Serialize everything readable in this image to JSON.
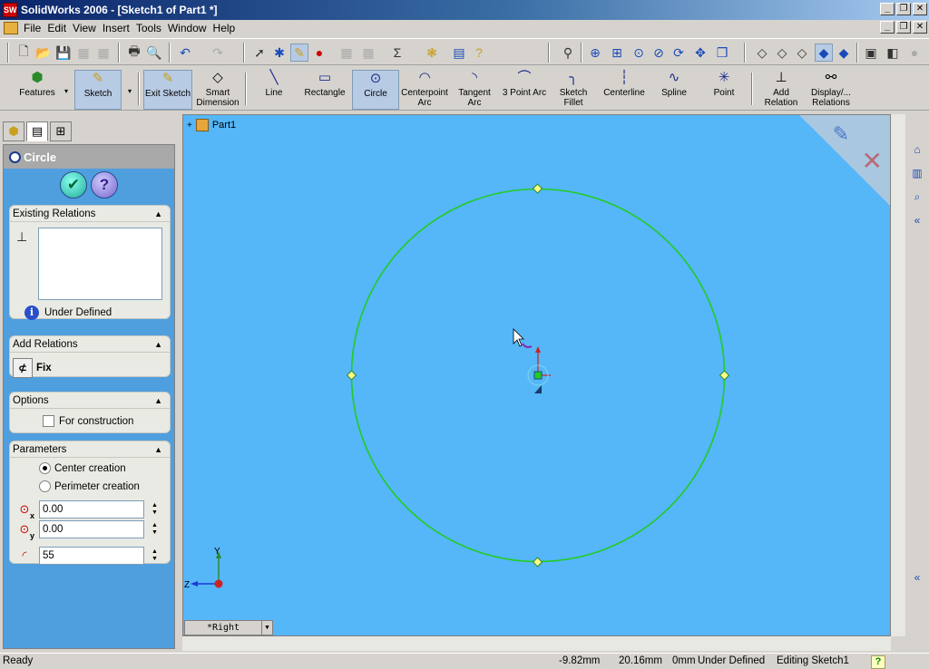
{
  "window": {
    "title": "SolidWorks 2006 - [Sketch1 of Part1 *]",
    "app_icon_label": "SW"
  },
  "menu": [
    "File",
    "Edit",
    "View",
    "Insert",
    "Tools",
    "Window",
    "Help"
  ],
  "command_manager": {
    "features": "Features",
    "sketch": "Sketch",
    "exit_sketch": "Exit Sketch",
    "smart_dimension": "Smart Dimension",
    "line": "Line",
    "rectangle": "Rectangle",
    "circle": "Circle",
    "centerpoint_arc": "Centerpoint Arc",
    "tangent_arc": "Tangent Arc",
    "three_point_arc": "3 Point Arc",
    "sketch_fillet": "Sketch Fillet",
    "centerline": "Centerline",
    "spline": "Spline",
    "point": "Point",
    "add_relation": "Add Relation",
    "display_relations": "Display/... Relations"
  },
  "property_manager": {
    "title": "Circle",
    "existing_relations": {
      "heading": "Existing Relations",
      "status": "Under Defined"
    },
    "add_relations": {
      "heading": "Add Relations",
      "fix_label": "Fix"
    },
    "options": {
      "heading": "Options",
      "for_construction": "For construction"
    },
    "parameters": {
      "heading": "Parameters",
      "center_creation": "Center creation",
      "perimeter_creation": "Perimeter creation",
      "selected_creation": "center",
      "center_x": "0.00",
      "center_y": "0.00",
      "radius": "55",
      "x_sub": "x",
      "y_sub": "y"
    }
  },
  "graphics": {
    "tree_root": "Part1",
    "view_name": "*Right",
    "triad_y": "Y",
    "triad_z": "Z",
    "background_color": "#55b6f8",
    "sketch_color": "#22cc22"
  },
  "status_bar": {
    "left": "Ready",
    "x": "-9.82mm",
    "y": "20.16mm",
    "z": "0mm",
    "state": "Under Defined",
    "mode": "Editing Sketch1",
    "help_label": "?"
  }
}
